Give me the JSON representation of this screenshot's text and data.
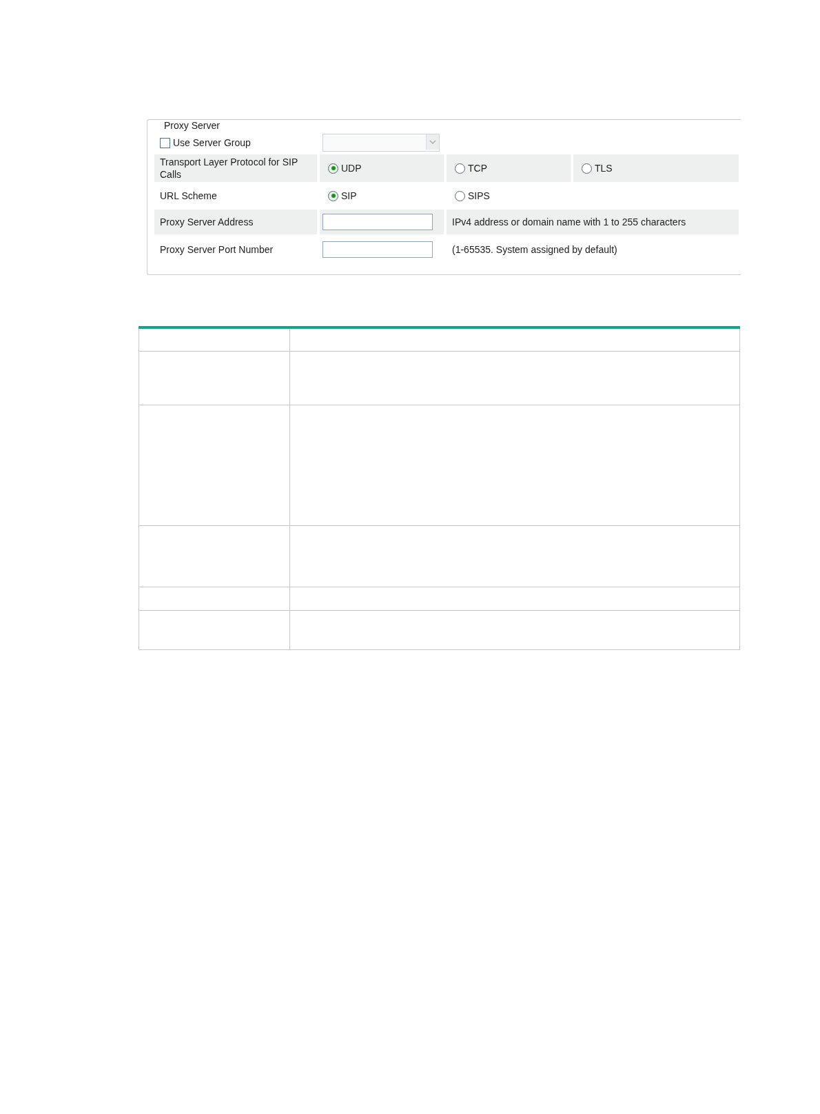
{
  "panel": {
    "legend": "Proxy Server",
    "use_server_group": {
      "label": "Use Server Group",
      "checked": false
    },
    "transport": {
      "label": "Transport Layer Protocol for SIP Calls",
      "options": [
        {
          "label": "UDP",
          "selected": true
        },
        {
          "label": "TCP",
          "selected": false
        },
        {
          "label": "TLS",
          "selected": false
        }
      ]
    },
    "url_scheme": {
      "label": "URL Scheme",
      "options": [
        {
          "label": "SIP",
          "selected": true
        },
        {
          "label": "SIPS",
          "selected": false
        }
      ]
    },
    "fields": [
      {
        "label": "Proxy Server Address",
        "hint": "IPv4 address or domain name with 1 to 255 characters"
      },
      {
        "label": "Proxy Server Port Number",
        "hint": "(1-65535. System assigned by default)"
      }
    ]
  }
}
